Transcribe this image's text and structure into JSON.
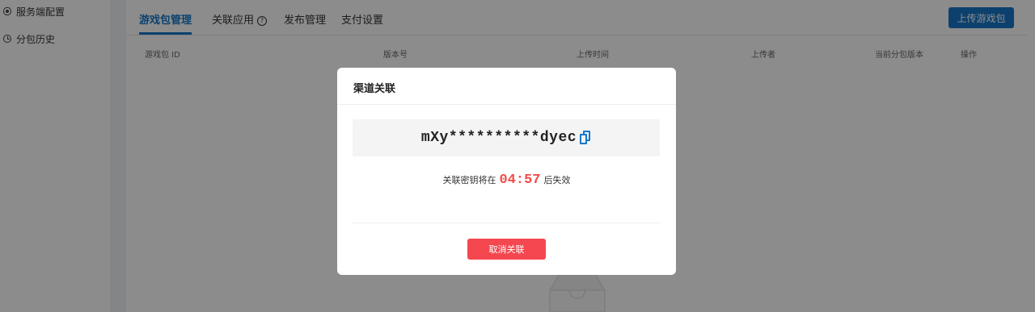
{
  "sidebar": {
    "items": [
      {
        "label": "服务端配置",
        "icon": "eye-icon"
      },
      {
        "label": "分包历史",
        "icon": "clock-icon"
      }
    ]
  },
  "tabs": [
    {
      "label": "游戏包管理",
      "active": true
    },
    {
      "label": "关联应用",
      "help_icon": "?"
    },
    {
      "label": "发布管理"
    },
    {
      "label": "支付设置"
    }
  ],
  "upload_button": "上传游戏包",
  "table": {
    "headers": [
      "游戏包 ID",
      "版本号",
      "上传时间",
      "上传者",
      "当前分包版本",
      "操作"
    ]
  },
  "modal": {
    "title": "渠道关联",
    "key": "mXy**********dyec",
    "expire_prefix": "关联密钥将在",
    "timer": "04:57",
    "expire_suffix": "后失效",
    "cancel_button": "取消关联"
  },
  "colors": {
    "accent": "#1677c9",
    "danger": "#f5474f",
    "timer": "#f24b4b"
  }
}
